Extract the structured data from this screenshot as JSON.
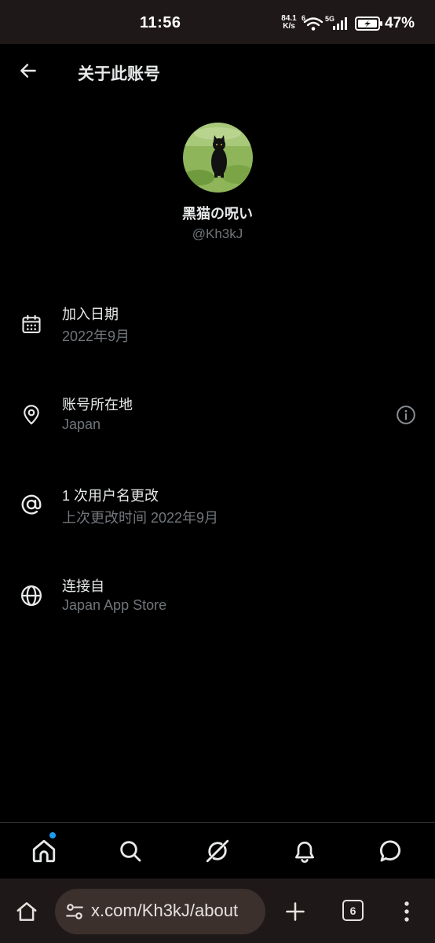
{
  "status_bar": {
    "time": "11:56",
    "net_speed_value": "84.1",
    "net_speed_unit": "K/s",
    "wifi_badge": "6",
    "signal_badge": "5G",
    "battery_percent": "47%"
  },
  "header": {
    "title": "关于此账号"
  },
  "profile": {
    "display_name": "黑猫の呪い",
    "handle": "@Kh3kJ"
  },
  "info_items": [
    {
      "icon": "calendar-icon",
      "title": "加入日期",
      "subtitle": "2022年9月"
    },
    {
      "icon": "location-pin-icon",
      "title": "账号所在地",
      "subtitle": "Japan",
      "trailing_icon": "info-circle-icon"
    },
    {
      "icon": "at-sign-icon",
      "title": "1 次用户名更改",
      "subtitle": "上次更改时间 2022年9月"
    },
    {
      "icon": "globe-icon",
      "title": "连接自",
      "subtitle": "Japan App Store"
    }
  ],
  "tab_bar": {
    "tabs": [
      "home-icon",
      "search-icon",
      "grok-icon",
      "bell-icon",
      "chat-bubble-icon"
    ],
    "home_has_notification": true
  },
  "browser": {
    "url": "x.com/Kh3kJ/about",
    "tab_count": "6"
  },
  "colors": {
    "background": "#000000",
    "primary_text": "#e7e9ea",
    "secondary_text": "#71767b",
    "accent": "#1d9bf0",
    "system_bar": "#1e1918",
    "url_pill": "#3b302c"
  }
}
